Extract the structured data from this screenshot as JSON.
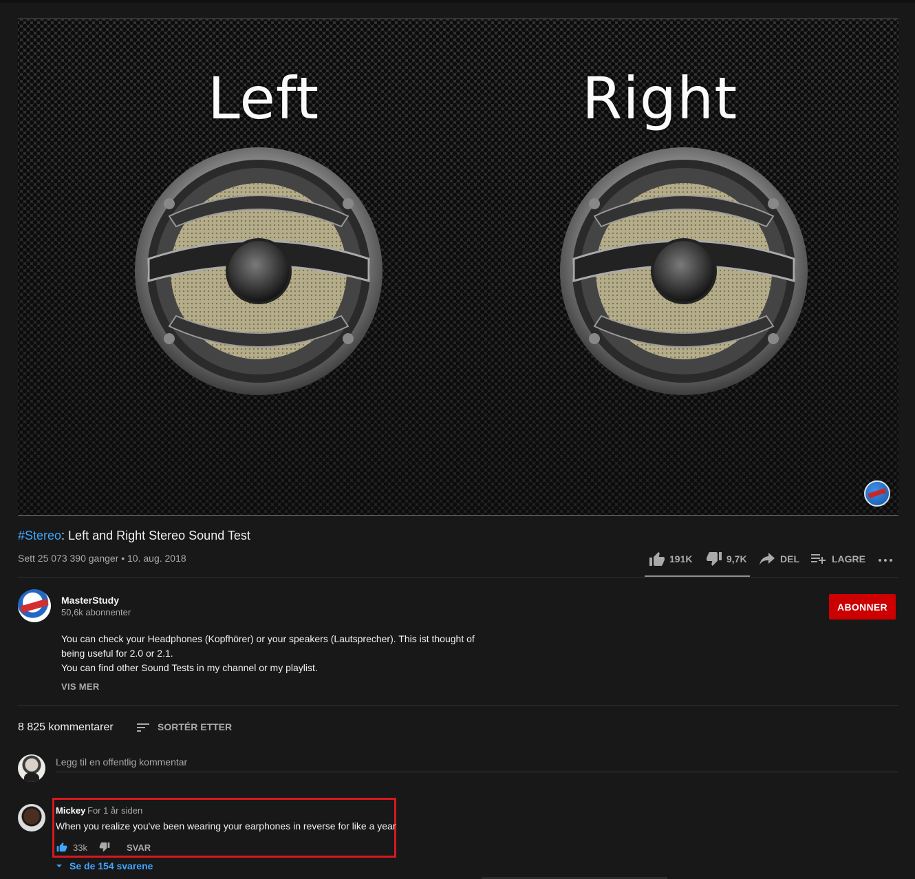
{
  "video": {
    "left_label": "Left",
    "right_label": "Right"
  },
  "title": {
    "hashtag": "#Stereo",
    "rest": ": Left and Right Stereo Sound Test"
  },
  "meta": {
    "views_date": "Sett 25 073 390 ganger • 10. aug. 2018"
  },
  "actions": {
    "likes": "191K",
    "dislikes": "9,7K",
    "share": "DEL",
    "save": "LAGRE",
    "like_ratio": 0.952
  },
  "channel": {
    "name": "MasterStudy",
    "subscribers": "50,6k abonnenter",
    "subscribe_label": "ABONNER"
  },
  "description": {
    "lines": [
      "You can check your Headphones (Kopfhörer) or your speakers (Lautsprecher). This ist thought of",
      "being useful for 2.0 or 2.1.",
      "You can find other Sound Tests in my channel or my playlist."
    ],
    "show_more": "VIS MER"
  },
  "comments": {
    "count": "8 825 kommentarer",
    "sort_label": "SORTÉR ETTER",
    "add_placeholder": "Legg til en offentlig kommentar",
    "items": [
      {
        "author": "Mickey",
        "time": "For 1 år siden",
        "text": "When you realize you've been wearing your earphones in reverse for like a year",
        "likes": "33k",
        "reply_label": "SVAR",
        "replies_label": "Se de 154 svarene"
      }
    ]
  },
  "colors": {
    "background": "#181818",
    "accent_blue": "#3ea6ff",
    "subscribe_red": "#cc0000",
    "highlight_red": "#d7191f"
  }
}
